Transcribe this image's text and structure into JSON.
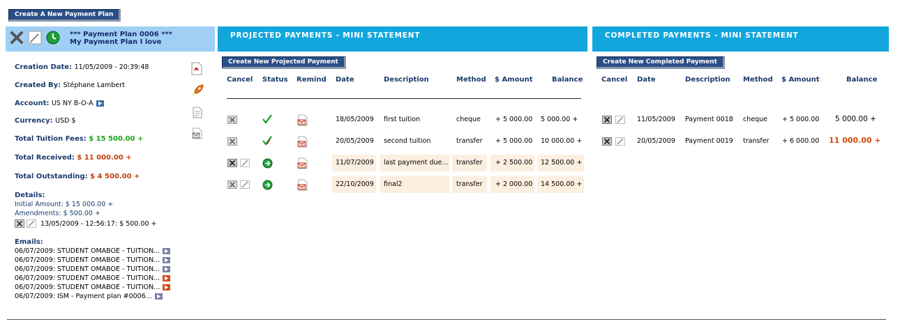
{
  "top_button": "Create A New Payment Plan",
  "plan": {
    "title_line1": "*** Payment Plan 0006 ***",
    "title_line2": "My Payment Plan I love",
    "creation_date_label": "Creation Date:",
    "creation_date": "11/05/2009 - 20:39:48",
    "created_by_label": "Created By:",
    "created_by": "Stéphane Lambert",
    "account_label": "Account:",
    "account": "US NY B-O-A",
    "currency_label": "Currency:",
    "currency": "USD $",
    "tuition_label": "Total Tuition Fees:",
    "tuition": "$ 15 500.00 +",
    "received_label": "Total Received:",
    "received": "$ 11 000.00 +",
    "outstanding_label": "Total Outstanding:",
    "outstanding": "$ 4 500.00 +",
    "details_label": "Details:",
    "initial_amount": "Initial Amount: $ 15 000.00 +",
    "amendments": "Amendments: $ 500.00 +",
    "amendment_item": "13/05/2009 - 12:56:17: $ 500.00 +",
    "emails_label": "Emails:",
    "emails": [
      {
        "text": "06/07/2009: STUDENT OMABOE - TUITION...",
        "status": "sent"
      },
      {
        "text": "06/07/2009: STUDENT OMABOE - TUITION...",
        "status": "sent"
      },
      {
        "text": "06/07/2009: STUDENT OMABOE - TUITION...",
        "status": "sent"
      },
      {
        "text": "06/07/2009: STUDENT OMABOE - TUITION...",
        "status": "pending"
      },
      {
        "text": "06/07/2009: STUDENT OMABOE - TUITION...",
        "status": "pending"
      },
      {
        "text": "06/07/2009: ISM - Payment plan #0006...",
        "status": "sent"
      }
    ]
  },
  "projected": {
    "title": "PROJECTED PAYMENTS - MINI STATEMENT",
    "button": "Create New Projected Payment",
    "headers": {
      "cancel": "Cancel",
      "status": "Status",
      "remind": "Remind",
      "date": "Date",
      "description": "Description",
      "method": "Method",
      "amount": "$ Amount",
      "balance": "Balance"
    },
    "rows": [
      {
        "date": "18/05/2009",
        "description": "first tuition",
        "method": "cheque",
        "amount": "+ 5 000.00",
        "balance": "5 000.00 +",
        "status": "paid"
      },
      {
        "date": "20/05/2009",
        "description": "second tuition",
        "method": "transfer",
        "amount": "+ 5 000.00",
        "balance": "10 000.00 +",
        "status": "paid"
      },
      {
        "date": "11/07/2009",
        "description": "last payment due...",
        "method": "transfer",
        "amount": "+ 2 500.00",
        "balance": "12 500.00 +",
        "status": "pending"
      },
      {
        "date": "22/10/2009",
        "description": "final2",
        "method": "transfer",
        "amount": "+ 2 000.00",
        "balance": "14 500.00 +",
        "status": "pending"
      }
    ]
  },
  "completed": {
    "title": "COMPLETED PAYMENTS - MINI STATEMENT",
    "button": "Create New Completed Payment",
    "headers": {
      "cancel": "Cancel",
      "date": "Date",
      "description": "Description",
      "method": "Method",
      "amount": "$ Amount",
      "balance": "Balance"
    },
    "rows": [
      {
        "date": "11/05/2009",
        "description": "Payment 0018",
        "method": "cheque",
        "amount": "+ 5 000.00",
        "balance": "5 000.00 +"
      },
      {
        "date": "20/05/2009",
        "description": "Payment 0019",
        "method": "transfer",
        "amount": "+ 6 000.00",
        "balance": "11 000.00 +"
      }
    ]
  },
  "colors": {
    "accent_blue": "#12a6dd",
    "light_blue": "#9fcff5",
    "button_navy": "#2a4f86",
    "green": "#1aa51a",
    "orange": "#c2410c"
  }
}
